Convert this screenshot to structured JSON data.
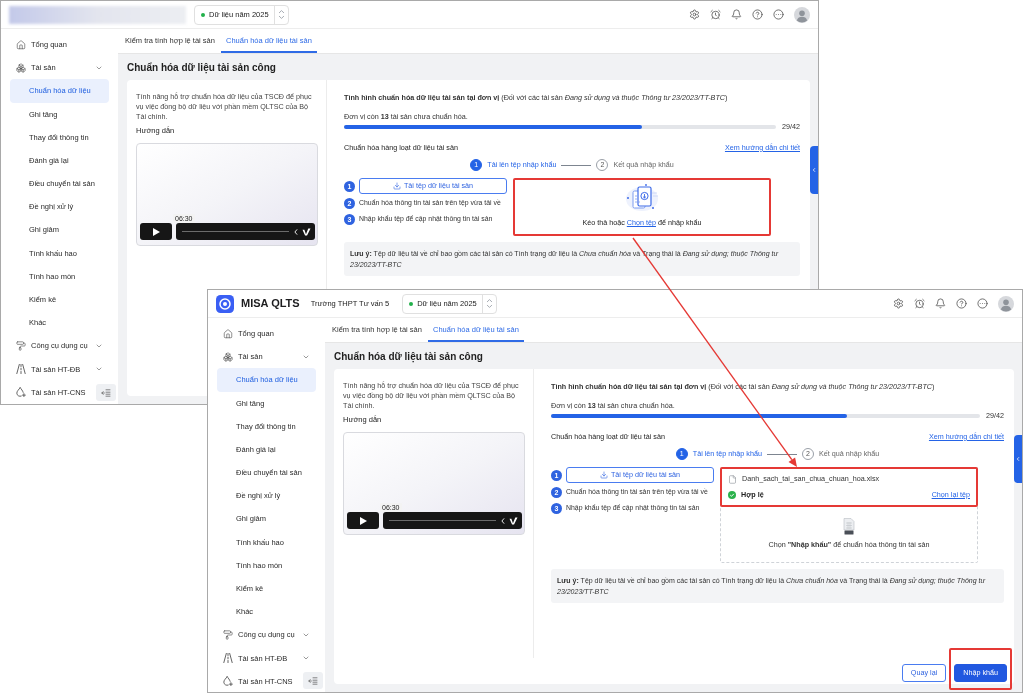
{
  "windows": [
    {
      "header": {
        "kind": "blurred",
        "year": "Dữ liệu năm 2025"
      },
      "sidebar": [
        {
          "label": "Tổng quan",
          "kind": "link"
        },
        {
          "label": "Tài sản",
          "kind": "group",
          "children": [
            {
              "label": "Chuẩn hóa dữ liệu",
              "selected": true
            },
            {
              "label": "Ghi tăng",
              "selected": false
            },
            {
              "label": "Thay đổi thông tin",
              "selected": false
            },
            {
              "label": "Đánh giá lại",
              "selected": false
            },
            {
              "label": "Điều chuyển tài sản",
              "selected": false
            },
            {
              "label": "Đề nghị xử lý",
              "selected": false
            },
            {
              "label": "Ghi giảm",
              "selected": false
            },
            {
              "label": "Tính khấu hao",
              "selected": false
            },
            {
              "label": "Tính hao mòn",
              "selected": false
            },
            {
              "label": "Kiểm kê",
              "selected": false
            },
            {
              "label": "Khác",
              "selected": false
            }
          ]
        },
        {
          "label": "Công cụ dụng cụ",
          "kind": "group"
        },
        {
          "label": "Tài sản HT-ĐB",
          "kind": "group"
        },
        {
          "label": "Tài sản HT-CNS",
          "kind": "link"
        }
      ],
      "tabs": [
        {
          "label": "Kiểm tra tính hợp lệ tài sản",
          "selected": false
        },
        {
          "label": "Chuẩn hóa dữ liệu tài sản",
          "selected": true
        }
      ],
      "page_title": "Chuẩn hóa dữ liệu tài sản công",
      "intro": "Tính năng hỗ trợ chuẩn hóa dữ liệu của TSCĐ để phục vụ việc đồng bộ dữ liệu với phần mềm QLTSC của Bộ Tài chính.",
      "guide_label": "Hướng dẫn",
      "video": {
        "time": "06:30"
      },
      "status_title": "**Tình hình chuẩn hóa dữ liệu tài sản tại đơn vị** (Đối với các tài sản *Đang sử dụng và thuộc Thông tư 23/2023/TT-BTC*)",
      "progress_text": "Đơn vị còn **13** tài sản chưa chuẩn hóa.",
      "progress": {
        "level": 0.69,
        "reading": "29/42"
      },
      "bulk_title": "Chuẩn hóa hàng loạt dữ liệu tài sản",
      "guide_link": "Xem hướng dẫn chi tiết",
      "steps": [
        {
          "number": "1",
          "label": "Tải lên tệp nhập khẩu",
          "selected": true
        },
        {
          "number": "2",
          "label": "Kết quả nhập khẩu",
          "selected": false
        }
      ],
      "instructions": [
        {
          "number": "1",
          "kind": "button",
          "label": "Tải tệp dữ liệu tài sản"
        },
        {
          "number": "2",
          "kind": "text",
          "label": "Chuẩn hóa thông tin tài sản trên tệp vừa tải về"
        },
        {
          "number": "3",
          "kind": "text",
          "label": "Nhập khẩu tệp để cập nhật thông tin tài sản"
        }
      ],
      "upload": {
        "kind": "dropzone",
        "highlighted": true,
        "prefix": "Kéo thả hoặc",
        "link": "Chọn tệp",
        "suffix": "để nhập khẩu"
      },
      "note": "**Lưu ý:** Tệp dữ liệu tải về chỉ bao gồm các tài sản có Tình trạng dữ liệu là *Chưa chuẩn hóa* và Trạng thái là *Đang sử dụng; thuộc Thông tư 23/2023/TT-BTC*"
    },
    {
      "header": {
        "kind": "brand",
        "app_name": "MISA QLTS",
        "school": "Trường THPT Tư vấn 5",
        "year": "Dữ liệu năm 2025"
      },
      "sidebar": [
        {
          "label": "Tổng quan",
          "kind": "link"
        },
        {
          "label": "Tài sản",
          "kind": "group",
          "children": [
            {
              "label": "Chuẩn hóa dữ liệu",
              "selected": true
            },
            {
              "label": "Ghi tăng",
              "selected": false
            },
            {
              "label": "Thay đổi thông tin",
              "selected": false
            },
            {
              "label": "Đánh giá lại",
              "selected": false
            },
            {
              "label": "Điều chuyển tài sản",
              "selected": false
            },
            {
              "label": "Đề nghị xử lý",
              "selected": false
            },
            {
              "label": "Ghi giảm",
              "selected": false
            },
            {
              "label": "Tính khấu hao",
              "selected": false
            },
            {
              "label": "Tính hao mòn",
              "selected": false
            },
            {
              "label": "Kiểm kê",
              "selected": false
            },
            {
              "label": "Khác",
              "selected": false
            }
          ]
        },
        {
          "label": "Công cụ dụng cụ",
          "kind": "group"
        },
        {
          "label": "Tài sản HT-ĐB",
          "kind": "group"
        },
        {
          "label": "Tài sản HT-CNS",
          "kind": "link"
        }
      ],
      "tabs": [
        {
          "label": "Kiểm tra tính hợp lệ tài sản",
          "selected": false
        },
        {
          "label": "Chuẩn hóa dữ liệu tài sản",
          "selected": true
        }
      ],
      "page_title": "Chuẩn hóa dữ liệu tài sản công",
      "intro": "Tính năng hỗ trợ chuẩn hóa dữ liệu của TSCĐ để phục vụ việc đồng bộ dữ liệu với phần mềm QLTSC của Bộ Tài chính.",
      "guide_label": "Hướng dẫn",
      "video": {
        "time": "06:30"
      },
      "status_title": "**Tình hình chuẩn hóa dữ liệu tài sản tại đơn vị** (Đối với các tài sản *Đang sử dụng và thuộc Thông tư 23/2023/TT-BTC*)",
      "progress_text": "Đơn vị còn **13** tài sản chưa chuẩn hóa.",
      "progress": {
        "level": 0.69,
        "reading": "29/42"
      },
      "bulk_title": "Chuẩn hóa hàng loạt dữ liệu tài sản",
      "guide_link": "Xem hướng dẫn chi tiết",
      "steps": [
        {
          "number": "1",
          "label": "Tải lên tệp nhập khẩu",
          "selected": true
        },
        {
          "number": "2",
          "label": "Kết quả nhập khẩu",
          "selected": false
        }
      ],
      "instructions": [
        {
          "number": "1",
          "kind": "button",
          "label": "Tải tệp dữ liệu tài sản"
        },
        {
          "number": "2",
          "kind": "text",
          "label": "Chuẩn hóa thông tin tài sản trên tệp vừa tải về"
        },
        {
          "number": "3",
          "kind": "text",
          "label": "Nhập khẩu tệp để cập nhật thông tin tài sản"
        }
      ],
      "upload": {
        "kind": "file",
        "highlighted": true,
        "file_name": "Danh_sach_tai_san_chua_chuan_hoa.xlsx",
        "status": "Hợp lệ",
        "relink": "Chọn lại tệp",
        "hint": "Chọn **\"Nhập khẩu\"** để chuẩn hóa thông tin tài sản"
      },
      "note": "**Lưu ý:** Tệp dữ liệu tải về chỉ bao gồm các tài sản có Tình trạng dữ liệu là *Chưa chuẩn hóa* và Trạng thái là *Đang sử dụng; thuộc Thông tư 23/2023/TT-BTC*",
      "footer_buttons": [
        {
          "label": "Quay lại",
          "kind": "secondary",
          "highlighted": false
        },
        {
          "label": "Nhập khẩu",
          "kind": "primary",
          "highlighted": true
        }
      ]
    }
  ]
}
